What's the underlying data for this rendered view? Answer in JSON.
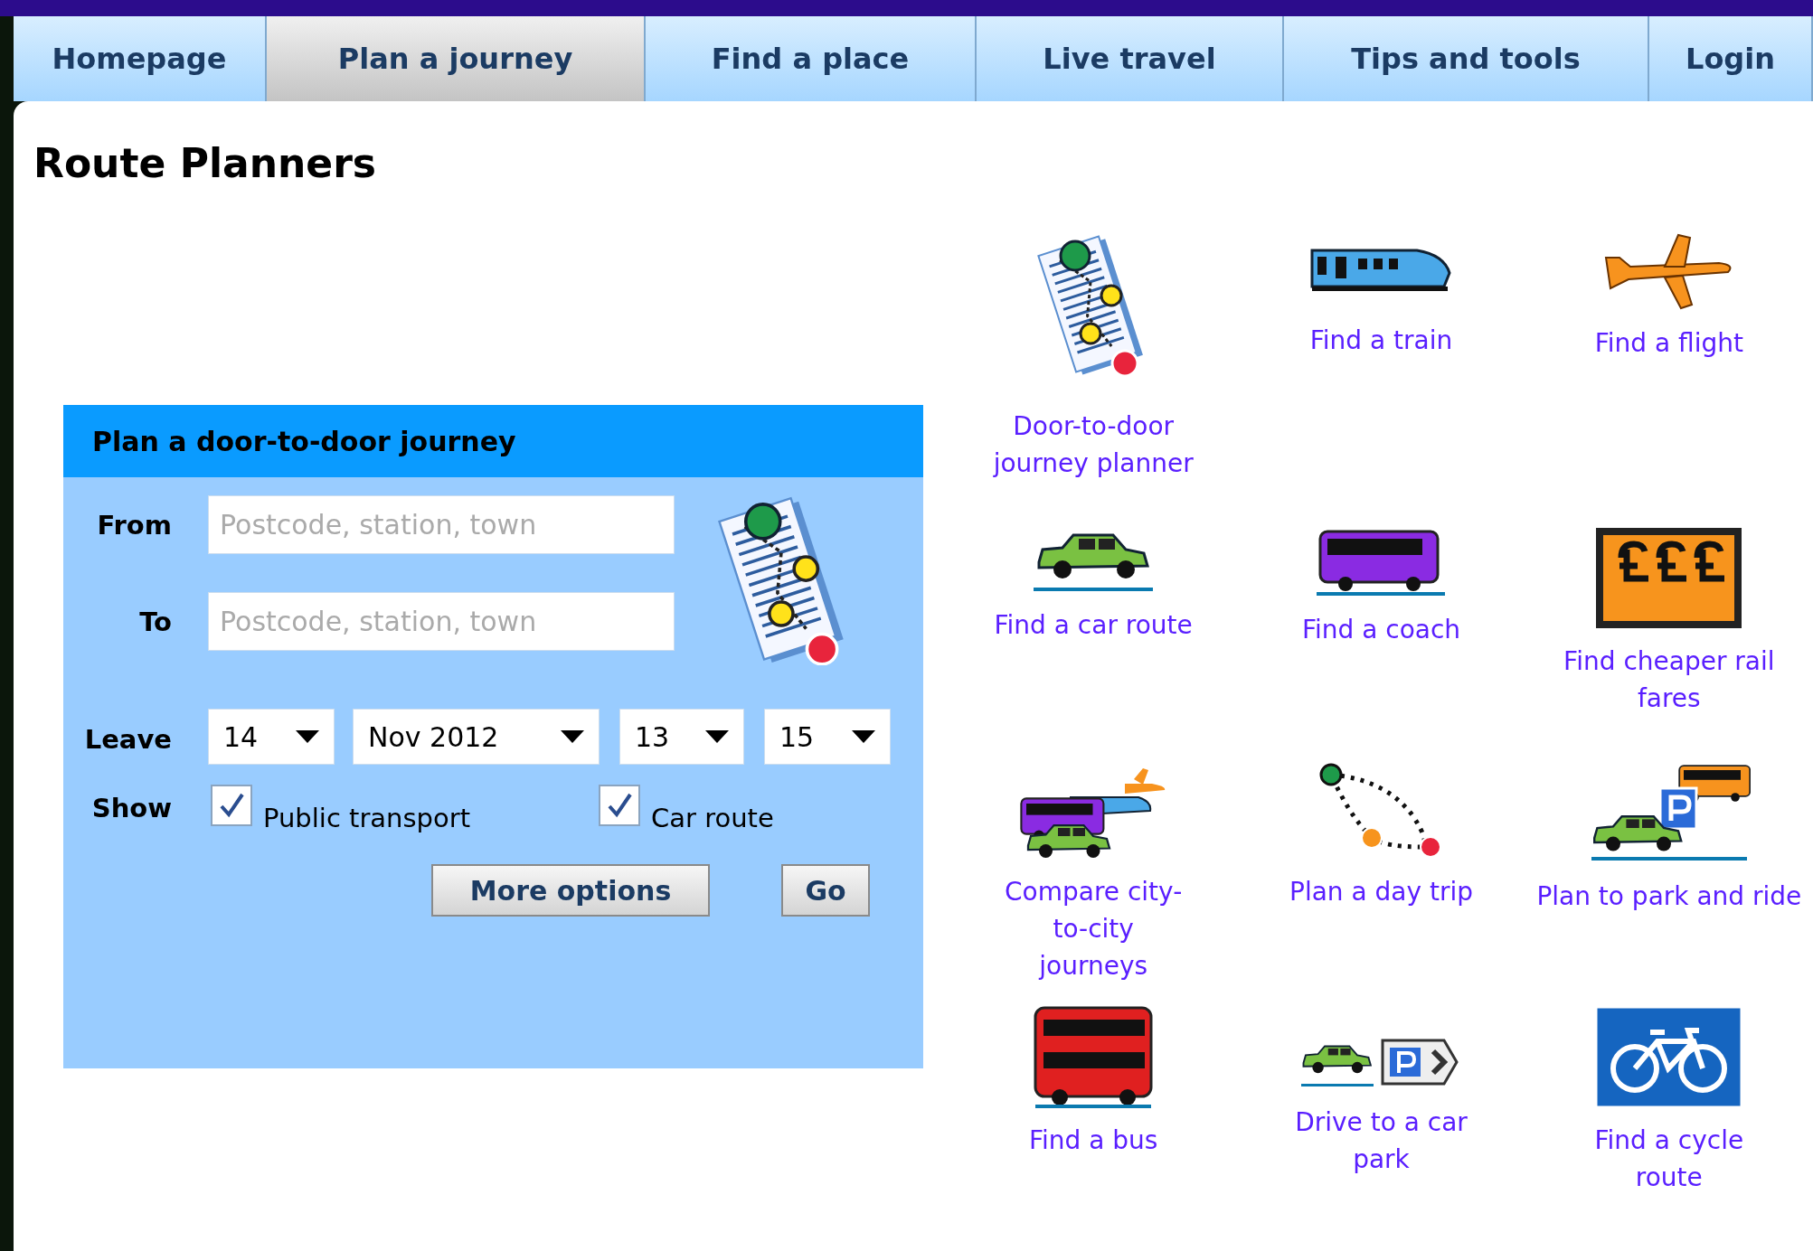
{
  "nav": [
    {
      "label": "Homepage",
      "selected": false
    },
    {
      "label": "Plan a journey",
      "selected": true
    },
    {
      "label": "Find a place",
      "selected": false
    },
    {
      "label": "Live travel",
      "selected": false
    },
    {
      "label": "Tips and tools",
      "selected": false
    },
    {
      "label": "Login",
      "selected": false
    }
  ],
  "heading": "Route Planners",
  "panel": {
    "title": "Plan a door-to-door journey",
    "fields": [
      {
        "label": "From",
        "placeholder": "Postcode, station, town"
      },
      {
        "label": "To",
        "placeholder": "Postcode, station, town"
      }
    ],
    "leave": {
      "label": "Leave",
      "selects": [
        "14",
        "Nov 2012",
        "13",
        "15"
      ]
    },
    "show": {
      "label": "Show",
      "options": [
        {
          "label": "Public transport",
          "checked": true
        },
        {
          "label": "Car route",
          "checked": true
        }
      ]
    },
    "buttons": [
      "More options",
      "Go"
    ]
  },
  "planners": [
    {
      "label": "Door-to-door journey planner",
      "kind": "journey"
    },
    {
      "label": "Find a train",
      "kind": "train"
    },
    {
      "label": "Find a flight",
      "kind": "flight"
    },
    {
      "label": "Find a car route",
      "kind": "car"
    },
    {
      "label": "Find a coach",
      "kind": "coach"
    },
    {
      "label": "Find cheaper rail fares",
      "kind": "fares"
    },
    {
      "label": "Compare city-to-city journeys",
      "kind": "compare"
    },
    {
      "label": "Plan a day trip",
      "kind": "daytrip"
    },
    {
      "label": "Plan to park and ride",
      "kind": "parkride"
    },
    {
      "label": "Find a bus",
      "kind": "bus"
    },
    {
      "label": "Drive to a car park",
      "kind": "carpark"
    },
    {
      "label": "Find a cycle route",
      "kind": "cycle"
    }
  ]
}
